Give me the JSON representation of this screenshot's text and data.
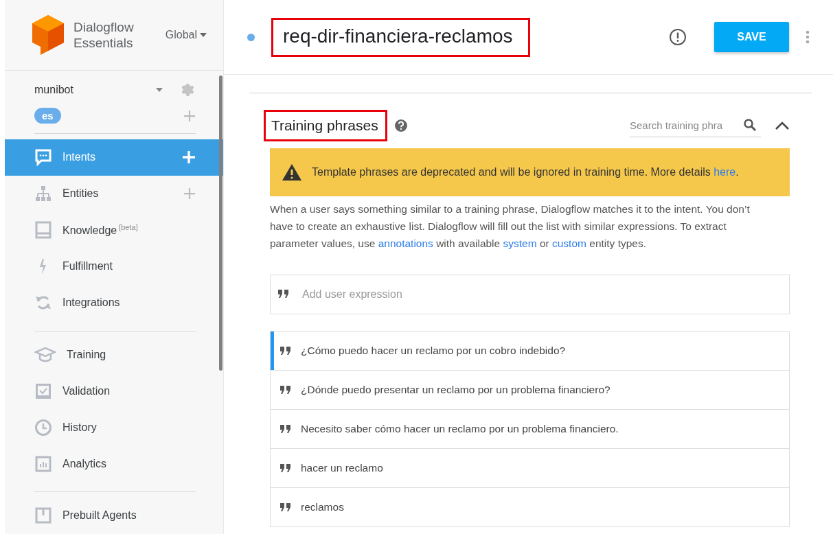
{
  "brand": {
    "line1": "Dialogflow",
    "line2": "Essentials",
    "region": "Global"
  },
  "agent": {
    "name": "munibot",
    "language": "es"
  },
  "nav_groups": [
    [
      {
        "label": "Intents",
        "selected": true,
        "add": true
      },
      {
        "label": "Entities",
        "selected": false,
        "add": true
      },
      {
        "label": "Knowledge",
        "sup": "[beta]",
        "selected": false,
        "add": false
      },
      {
        "label": "Fulfillment",
        "selected": false,
        "add": false
      },
      {
        "label": "Integrations",
        "selected": false,
        "add": false
      }
    ],
    [
      {
        "label": "Training",
        "selected": false,
        "add": false
      },
      {
        "label": "Validation",
        "selected": false,
        "add": false
      },
      {
        "label": "History",
        "selected": false,
        "add": false
      },
      {
        "label": "Analytics",
        "selected": false,
        "add": false
      }
    ],
    [
      {
        "label": "Prebuilt Agents",
        "selected": false,
        "add": false
      }
    ]
  ],
  "intent": {
    "title": "req-dir-financiera-reclamos",
    "highlighted": true,
    "save": "SAVE"
  },
  "section": {
    "title": "Training phrases",
    "highlighted": true,
    "search_placeholder": "Search training phra",
    "warning": {
      "text": "Template phrases are deprecated and will be ignored in training time. More details ",
      "link": "here",
      "after": "."
    },
    "description": [
      {
        "text": "When a user says something similar to a training phrase, Dialogflow matches it to the intent. You don’t have to create an exhaustive list. Dialogflow will fill out the list with similar expressions. To extract parameter values, use ",
        "link": false
      },
      {
        "text": "annotations",
        "link": true
      },
      {
        "text": " with available ",
        "link": false
      },
      {
        "text": "system",
        "link": true
      },
      {
        "text": " or ",
        "link": false
      },
      {
        "text": "custom",
        "link": true
      },
      {
        "text": " entity types.",
        "link": false
      }
    ],
    "add_placeholder": "Add user expression",
    "phrases": [
      {
        "text": "¿Cómo puedo hacer un reclamo por un cobro indebido?",
        "selected": true
      },
      {
        "text": "¿Dónde puedo presentar un reclamo por un problema financiero?",
        "selected": false
      },
      {
        "text": "Necesito saber cómo hacer un reclamo por un problema financiero.",
        "selected": false
      },
      {
        "text": "hacer un reclamo",
        "selected": false
      },
      {
        "text": "reclamos",
        "selected": false
      }
    ]
  }
}
